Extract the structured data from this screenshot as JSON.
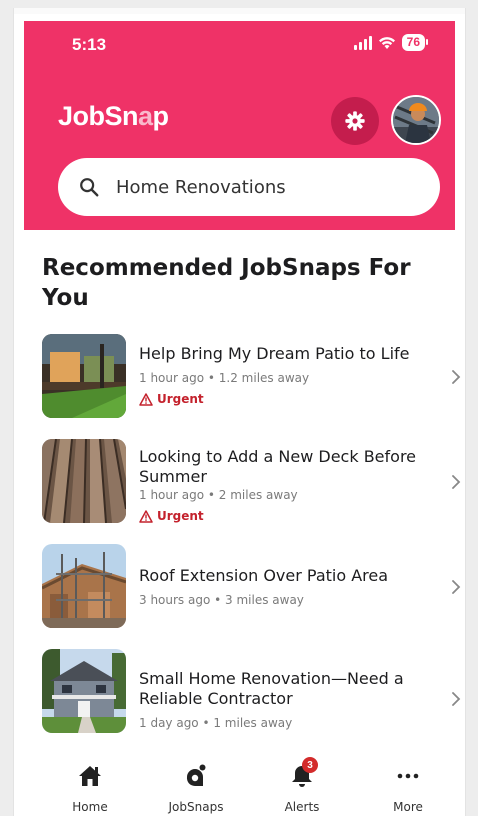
{
  "status_bar": {
    "time": "5:13",
    "battery": "76"
  },
  "header": {
    "logo_left": "JobSn",
    "logo_accent": "a",
    "logo_right": "p",
    "search_value": "Home Renovations"
  },
  "colors": {
    "brand": "#ef3267",
    "brand_dark": "#c41d4d",
    "urgent": "#c4222d"
  },
  "section": {
    "title": "Recommended JobSnaps For You"
  },
  "jobs": [
    {
      "title": "Help Bring My Dream Patio to Life",
      "meta": "1 hour ago • 1.2 miles away",
      "urgent": "Urgent"
    },
    {
      "title": "Looking to Add a New Deck Before Summer",
      "meta": "1 hour ago • 2 miles away",
      "urgent": "Urgent"
    },
    {
      "title": "Roof Extension Over Patio Area",
      "meta": "3 hours ago • 3 miles away"
    },
    {
      "title": "Small Home Renovation—Need a Reliable Contractor",
      "meta": "1 day ago • 1 miles away"
    }
  ],
  "nav": {
    "items": [
      {
        "label": "Home",
        "icon": "home-icon"
      },
      {
        "label": "JobSnaps",
        "icon": "jobsnaps-icon"
      },
      {
        "label": "Alerts",
        "icon": "bell-icon",
        "badge": "3"
      },
      {
        "label": "More",
        "icon": "more-icon"
      }
    ]
  }
}
